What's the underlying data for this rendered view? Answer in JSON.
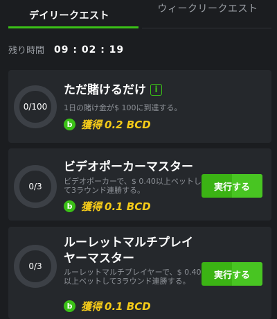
{
  "tabs": {
    "daily": "デイリークエスト",
    "weekly": "ウィークリークエスト"
  },
  "timer": {
    "label": "残り時間",
    "value": "09 : 02 : 19"
  },
  "quests": [
    {
      "progress": "0/100",
      "title": "ただ賭けるだけ",
      "info_icon": "i",
      "description": "1日の賭け金が$ 100に到達する。",
      "reward_label": "獲得",
      "reward_amount": "0.2 BCD"
    },
    {
      "progress": "0/3",
      "title": "ビデオポーカーマスター",
      "description": "ビデオポーカーで、$ 0.40以上ベットして3ラウンド連勝する。",
      "reward_label": "獲得",
      "reward_amount": "0.1 BCD",
      "button": "実行する"
    },
    {
      "progress": "0/3",
      "title": "ルーレットマルチプレイヤーマスター",
      "description": "ルーレットマルチプレイヤーで、$ 0.40以上ベットして3ラウンド連勝する。",
      "reward_label": "獲得",
      "reward_amount": "0.1 BCD",
      "button": "実行する"
    }
  ],
  "coin_glyph": "b",
  "colors": {
    "accent_green": "#3bc117",
    "reward_yellow": "#f5cb19",
    "background": "#1b1d20",
    "card": "#25282c"
  }
}
